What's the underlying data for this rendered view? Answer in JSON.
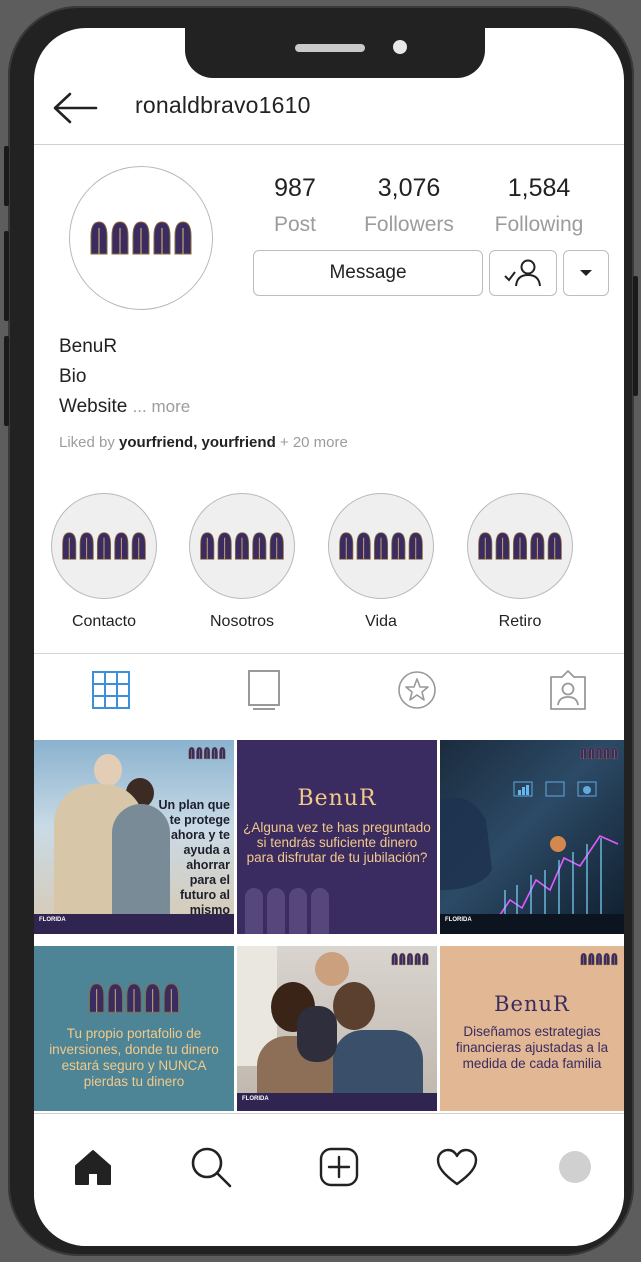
{
  "header": {
    "username": "ronaldbravo1610"
  },
  "profile": {
    "stats": [
      {
        "value": "987",
        "label": "Post"
      },
      {
        "value": "3,076",
        "label": "Followers"
      },
      {
        "value": "1,584",
        "label": "Following"
      }
    ],
    "message_label": "Message",
    "name": "BenuR",
    "bio": "Bio",
    "website": "Website",
    "more": "... more",
    "liked_prefix": "Liked by",
    "liked_names": "yourfriend, yourfriend",
    "liked_suffix": "+ 20 more"
  },
  "highlights": [
    "Contacto",
    "Nosotros",
    "Vida",
    "Retiro"
  ],
  "posts": {
    "p1_text": "Un plan que te protege ahora y te ayuda a ahorrar para el futuro al mismo tiempo",
    "p1_foot": "FLORIDA",
    "p2_brand": "BenuR",
    "p2_text": "¿Alguna vez te has preguntado si tendrás suficiente dinero para disfrutar de tu jubilación?",
    "p3_foot": "FLORIDA",
    "p4_text": "Tu propio portafolio de inversiones, donde tu dinero estará seguro y NUNCA pierdas tu dinero",
    "p5_foot": "FLORIDA",
    "p6_brand": "BenuR",
    "p6_text": "Diseñamos estrategias financieras ajustadas a la medida de cada familia"
  },
  "colors": {
    "brand_purple": "#3a2b60",
    "grid_blue": "#3d8fd9",
    "teal_tile": "#4d8596",
    "peach_tile": "#e2b894",
    "accent_yellow": "#f3c98a"
  },
  "icons": {
    "back": "arrow-left-icon",
    "follow": "user-check-icon",
    "dropdown": "chevron-down-icon",
    "grid": "grid-icon",
    "igtv": "tv-icon",
    "saved": "star-icon",
    "tagged": "tag-user-icon",
    "home": "home-icon",
    "search": "search-icon",
    "add": "add-post-icon",
    "likes": "heart-icon",
    "profile": "profile-icon"
  }
}
